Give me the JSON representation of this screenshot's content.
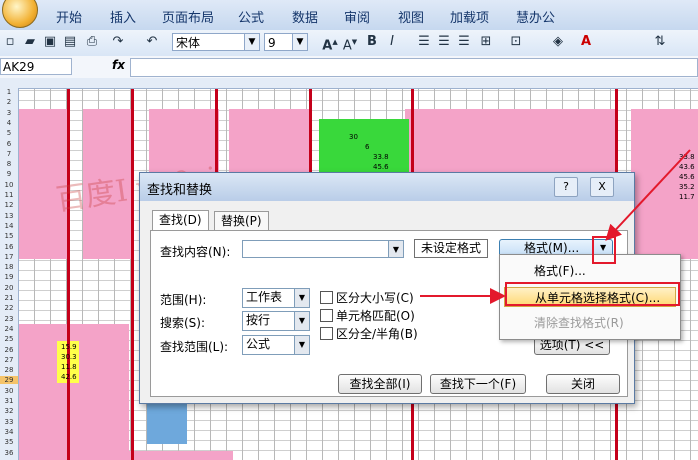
{
  "ribbon": {
    "tabs": [
      "开始",
      "插入",
      "页面布局",
      "公式",
      "数据",
      "审阅",
      "视图",
      "加载项",
      "慧办公"
    ]
  },
  "toolbar": {
    "font_name": "宋体",
    "font_size": "9"
  },
  "formula_bar": {
    "cell_ref": "AK29",
    "fx": "fx"
  },
  "rows": [
    "1",
    "2",
    "3",
    "4",
    "5",
    "6",
    "7",
    "8",
    "9",
    "10",
    "11",
    "12",
    "13",
    "14",
    "15",
    "16",
    "17",
    "18",
    "19",
    "20",
    "21",
    "22",
    "23",
    "24",
    "25",
    "26",
    "27",
    "28",
    "29",
    "30",
    "31",
    "32",
    "33",
    "34",
    "35",
    "36"
  ],
  "sheet_values": {
    "left_col": [
      "15.9",
      "30.3",
      "11.8",
      "42.6"
    ],
    "green_col": [
      "30",
      "6",
      "33.8",
      "45.6"
    ],
    "right_col": [
      "33.8",
      "43.6",
      "45.6",
      "35.2",
      "11.7"
    ]
  },
  "watermark": "百度I yu0zi",
  "dialog": {
    "title": "查找和替换",
    "help": "?",
    "close": "X",
    "tabs": [
      "查找(D)",
      "替换(P)"
    ],
    "find_label": "查找内容(N):",
    "find_value": "",
    "format_status": "未设定格式",
    "format_button": "格式(M)...",
    "scope_label": "范围(H):",
    "scope_value": "工作表",
    "search_label": "搜索(S):",
    "search_value": "按行",
    "lookin_label": "查找范围(L):",
    "lookin_value": "公式",
    "options": [
      "区分大小写(C)",
      "单元格匹配(O)",
      "区分全/半角(B)"
    ],
    "options_button": "选项(T) <<",
    "find_all": "查找全部(I)",
    "find_next": "查找下一个(F)",
    "close_button": "关闭"
  },
  "format_menu": {
    "items": [
      "格式(F)...",
      "从单元格选择格式(C)...",
      "清除查找格式(R)"
    ]
  },
  "colors": {
    "pink": "#f4a3c8",
    "green": "#39d83b",
    "red": "#c4001a",
    "annotation": "#e3192c"
  }
}
